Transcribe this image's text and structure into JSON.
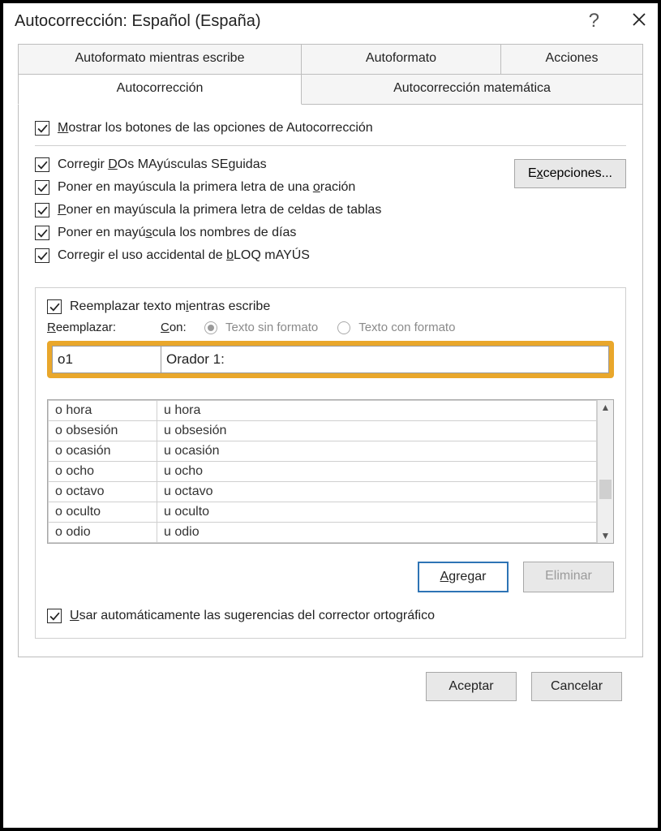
{
  "title": "Autocorrección: Español (España)",
  "help_symbol": "?",
  "tabs": {
    "top": [
      "Autoformato mientras escribe",
      "Autoformato",
      "Acciones"
    ],
    "bottom": [
      "Autocorrección",
      "Autocorrección matemática"
    ]
  },
  "show_buttons_label_pre": "M",
  "show_buttons_label_post": "ostrar los botones de las opciones de Autocorrección",
  "corr1_pre": "Corregir ",
  "corr1_u": "D",
  "corr1_post": "Os MAyúsculas SEguidas",
  "corr2_pre": "Poner en mayúscula la primera letra de una ",
  "corr2_u": "o",
  "corr2_post": "ración",
  "corr3_u": "P",
  "corr3_post": "oner en mayúscula la primera letra de celdas de tablas",
  "corr4_pre": "Poner en mayú",
  "corr4_u": "s",
  "corr4_post": "cula los nombres de días",
  "corr5_pre": "Corregir el uso accidental de ",
  "corr5_u": "b",
  "corr5_post": "LOQ mAYÚS",
  "exceptions_btn_pre": "E",
  "exceptions_btn_u": "x",
  "exceptions_btn_post": "cepciones...",
  "replace_chk_pre": "Reemplazar texto m",
  "replace_chk_u": "i",
  "replace_chk_post": "entras escribe",
  "label_replace_u": "R",
  "label_replace_post": "eemplazar:",
  "label_with_u": "C",
  "label_with_post": "on:",
  "radio_plain": "Texto sin formato",
  "radio_formatted": "Texto con formato",
  "input_replace": "o1",
  "input_with": "Orador 1:",
  "entries": [
    {
      "a": "o hora",
      "b": "u hora"
    },
    {
      "a": "o obsesión",
      "b": "u obsesión"
    },
    {
      "a": "o ocasión",
      "b": "u ocasión"
    },
    {
      "a": "o ocho",
      "b": "u ocho"
    },
    {
      "a": "o octavo",
      "b": "u octavo"
    },
    {
      "a": "o oculto",
      "b": "u oculto"
    },
    {
      "a": "o odio",
      "b": "u odio"
    }
  ],
  "btn_add_u": "A",
  "btn_add_post": "gregar",
  "btn_delete": "Eliminar",
  "spellcheck_chk_u": "U",
  "spellcheck_chk_post": "sar automáticamente las sugerencias del corrector ortográfico",
  "btn_ok": "Aceptar",
  "btn_cancel": "Cancelar"
}
